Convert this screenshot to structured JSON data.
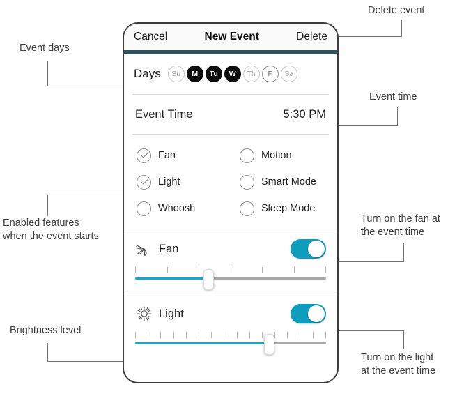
{
  "annotations": [
    {
      "id": "event-days",
      "text": "Event days"
    },
    {
      "id": "enabled-features",
      "text": "Enabled features\nwhen the event starts"
    },
    {
      "id": "brightness-level",
      "text": "Brightness level"
    },
    {
      "id": "delete-event",
      "text": "Delete event"
    },
    {
      "id": "event-time",
      "text": "Event time"
    },
    {
      "id": "turn-on-fan",
      "text": "Turn on the fan at\nthe event time"
    },
    {
      "id": "turn-on-light",
      "text": "Turn on the light\nat the event time"
    }
  ],
  "phone": {
    "navbar": {
      "cancel_label": "Cancel",
      "title": "New Event",
      "delete_label": "Delete"
    },
    "days": {
      "label": "Days",
      "items": [
        {
          "abbr": "Su",
          "selected": false,
          "emphasis": "light"
        },
        {
          "abbr": "M",
          "selected": true,
          "emphasis": "on"
        },
        {
          "abbr": "Tu",
          "selected": true,
          "emphasis": "on"
        },
        {
          "abbr": "W",
          "selected": true,
          "emphasis": "on"
        },
        {
          "abbr": "Th",
          "selected": false,
          "emphasis": "light"
        },
        {
          "abbr": "F",
          "selected": false,
          "emphasis": "dark"
        },
        {
          "abbr": "Sa",
          "selected": false,
          "emphasis": "light"
        }
      ]
    },
    "event_time": {
      "label": "Event Time",
      "value": "5:30 PM"
    },
    "features": [
      {
        "label": "Fan",
        "checked": true
      },
      {
        "label": "Motion",
        "checked": false
      },
      {
        "label": "Light",
        "checked": true
      },
      {
        "label": "Smart Mode",
        "checked": false
      },
      {
        "label": "Whoosh",
        "checked": false
      },
      {
        "label": "Sleep Mode",
        "checked": false
      }
    ],
    "controls": [
      {
        "id": "fan",
        "icon": "fan-blade-icon",
        "label": "Fan",
        "toggle_on": true,
        "slider": {
          "ticks": 7,
          "value_index": 3,
          "fill_percent": 38
        }
      },
      {
        "id": "light",
        "icon": "sun-icon",
        "label": "Light",
        "toggle_on": true,
        "slider": {
          "ticks": 16,
          "value_index": 11,
          "fill_percent": 70
        }
      }
    ]
  },
  "colors": {
    "accent_toggle": "#0f9dbd",
    "accent_slider": "#14a7d6",
    "navrule": "#2d5460",
    "day_on": "#0d0d0d"
  }
}
